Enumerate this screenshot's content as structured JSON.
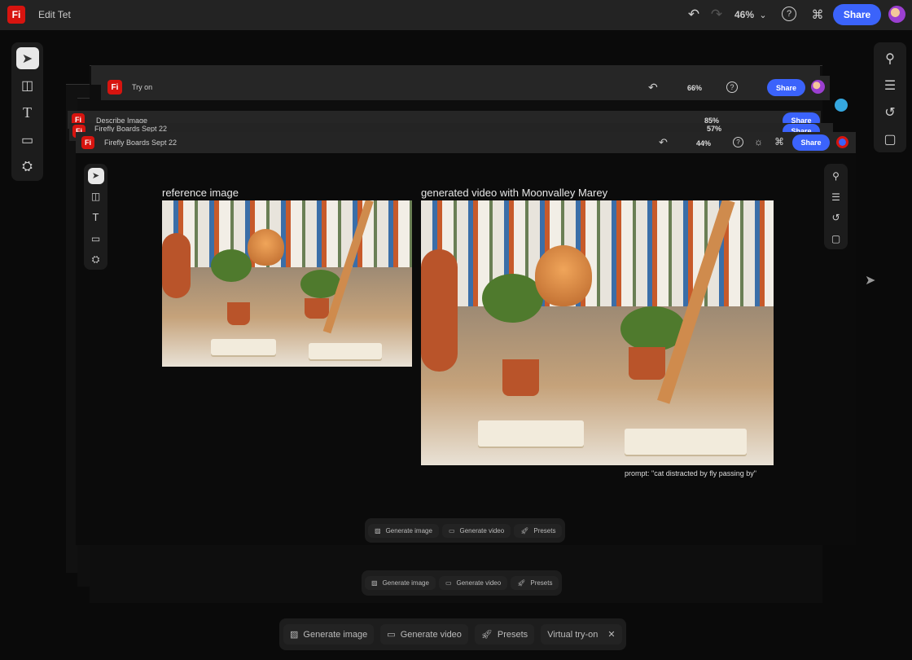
{
  "main_window": {
    "title": "Edit Tet",
    "zoom": "46%",
    "share_label": "Share"
  },
  "stacked_windows": [
    {
      "title": "Try on",
      "zoom": "66%",
      "share_label": "Share"
    },
    {
      "title": "Describe Image",
      "zoom": "85%",
      "share_label": "Share"
    },
    {
      "title": "Firefly Boards Sept 22",
      "zoom": "57%",
      "share_label": "Share"
    }
  ],
  "front_window": {
    "title": "Firefly Boards Sept 22",
    "zoom": "44%",
    "share_label": "Share",
    "reference_label": "reference image",
    "generated_label": "generated video with Moonvalley Marey",
    "prompt": "prompt: \"cat distracted by fly passing by\"",
    "bottom_toolbar": [
      "Generate image",
      "Generate video",
      "Presets"
    ]
  },
  "middle_toolbar": [
    "Generate image",
    "Generate video",
    "Presets"
  ],
  "bottom_toolbar": {
    "items": [
      "Generate image",
      "Generate video",
      "Presets"
    ],
    "chip": "Virtual try-on"
  },
  "logo_text": "Fi",
  "colors": {
    "accent": "#3b63fb",
    "brand": "#d7140f"
  },
  "left_tools": [
    "select-icon",
    "frame-icon",
    "text-icon",
    "shape-icon",
    "generate-fill-icon"
  ],
  "right_tools": [
    "search-icon",
    "adjust-icon",
    "history-icon",
    "comment-icon"
  ]
}
